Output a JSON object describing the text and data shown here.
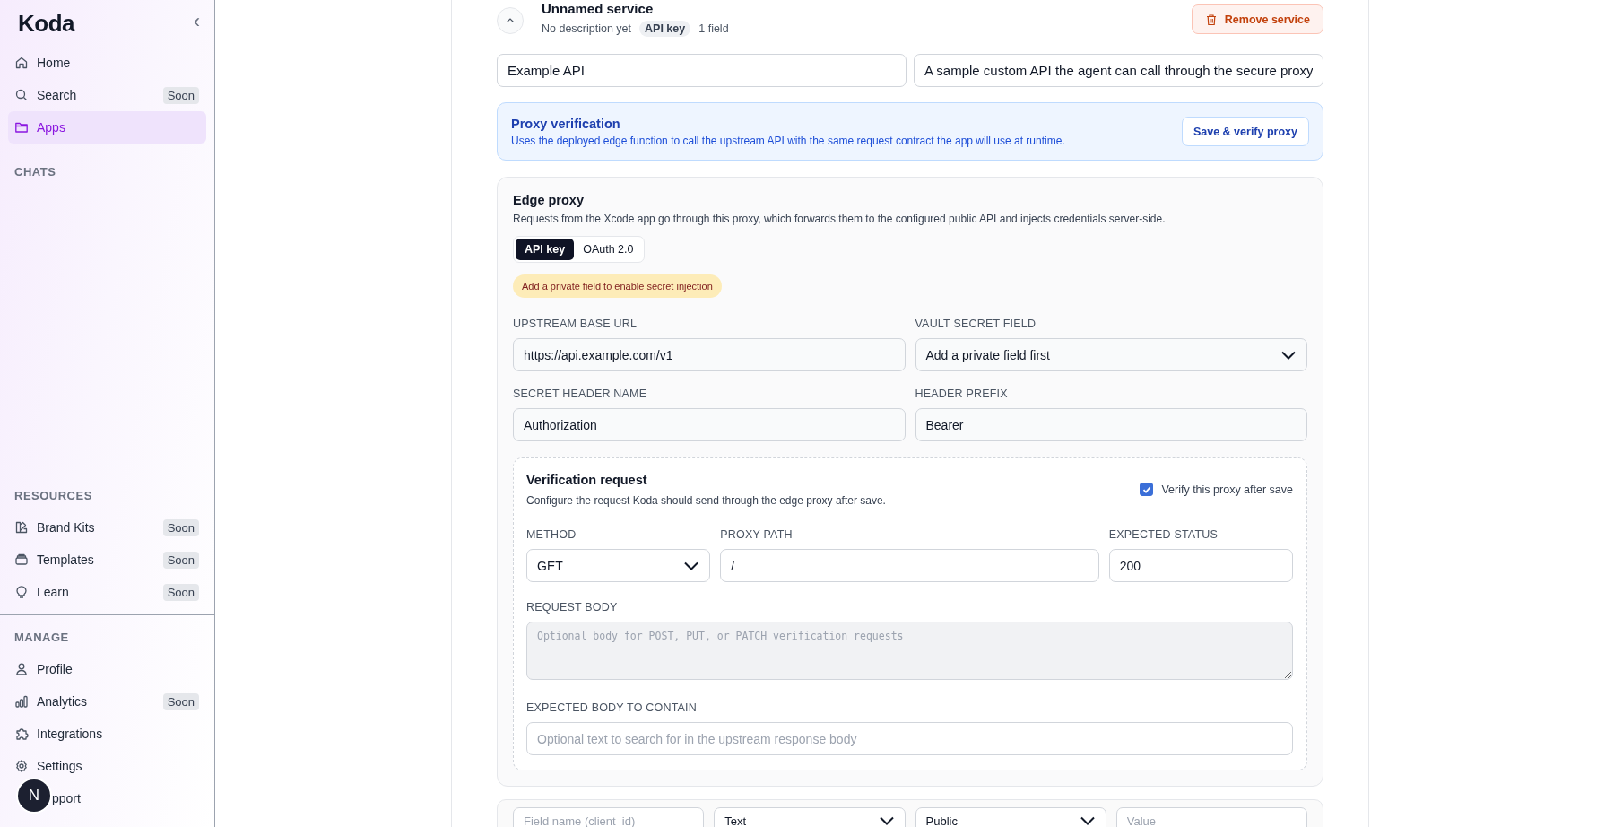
{
  "sidebar": {
    "logo": "Koda",
    "collapse_button": "‹",
    "primary": [
      {
        "label": "Home",
        "selected": false
      },
      {
        "label": "Search",
        "badge": "Soon",
        "selected": false
      },
      {
        "label": "Apps",
        "selected": true
      }
    ],
    "chats_heading": "CHATS",
    "resources": {
      "title": "RESOURCES",
      "items": [
        {
          "label": "Brand Kits",
          "badge": "Soon",
          "selected": false
        },
        {
          "label": "Templates",
          "badge": "Soon",
          "selected": false
        },
        {
          "label": "Learn",
          "badge": "Soon",
          "selected": false
        }
      ]
    },
    "manage": {
      "title": "MANAGE",
      "items": [
        {
          "label": "Profile",
          "selected": false
        },
        {
          "label": "Analytics",
          "badge": "Soon",
          "selected": false
        },
        {
          "label": "Integrations",
          "selected": false
        },
        {
          "label": "Settings",
          "selected": false
        },
        {
          "label": "pport",
          "selected": false
        }
      ]
    },
    "avatar": {
      "initial": "N"
    }
  },
  "service": {
    "title": "Unnamed service",
    "expanded": true,
    "description": "No description yet",
    "auth_badge": "API key",
    "field_count": "1 field",
    "remove_button": "Remove service",
    "name_value": "Example API",
    "description_value": "A sample custom API the agent can call through the secure proxy"
  },
  "proxy_verification": {
    "title": "Proxy verification",
    "text": "Uses the deployed edge function to call the upstream API with the same request contract the app will use at runtime.",
    "button": "Save & verify proxy"
  },
  "edge_proxy": {
    "title": "Edge proxy",
    "description": "Requests from the Xcode app go through this proxy, which forwards them to the configured public API and injects credentials server-side.",
    "auth_tabs": [
      {
        "label": "API key",
        "selected": true
      },
      {
        "label": "OAuth 2.0",
        "selected": false
      }
    ],
    "warning": "Add a private field to enable secret injection",
    "fields": [
      {
        "label": "UPSTREAM BASE URL",
        "value": "https://api.example.com/v1",
        "kind": "input"
      },
      {
        "label": "VAULT SECRET FIELD",
        "value": "Add a private field first",
        "kind": "select"
      },
      {
        "label": "SECRET HEADER NAME",
        "value": "Authorization",
        "kind": "input"
      },
      {
        "label": "HEADER PREFIX",
        "value": "Bearer",
        "kind": "input"
      }
    ]
  },
  "verification": {
    "title": "Verification request",
    "description": "Configure the request Koda should send through the edge proxy after save.",
    "verify_after_save": {
      "label": "Verify this proxy after save",
      "checked": true
    },
    "fields": [
      {
        "label": "METHOD",
        "value": "GET",
        "kind": "select"
      },
      {
        "label": "PROXY PATH",
        "value": "/",
        "kind": "input"
      },
      {
        "label": "EXPECTED STATUS",
        "value": "200",
        "kind": "input"
      }
    ],
    "request_body": {
      "label": "REQUEST BODY",
      "placeholder": "Optional body for POST, PUT, or PATCH verification requests"
    },
    "expected_body": {
      "label": "EXPECTED BODY TO CONTAIN",
      "placeholder": "Optional text to search for in the upstream response body"
    }
  },
  "field_row": [
    {
      "kind": "input",
      "placeholder": "Field name (client_id)"
    },
    {
      "kind": "select",
      "value": "Text"
    },
    {
      "kind": "select",
      "value": "Public"
    },
    {
      "kind": "input",
      "placeholder": "Value"
    }
  ]
}
